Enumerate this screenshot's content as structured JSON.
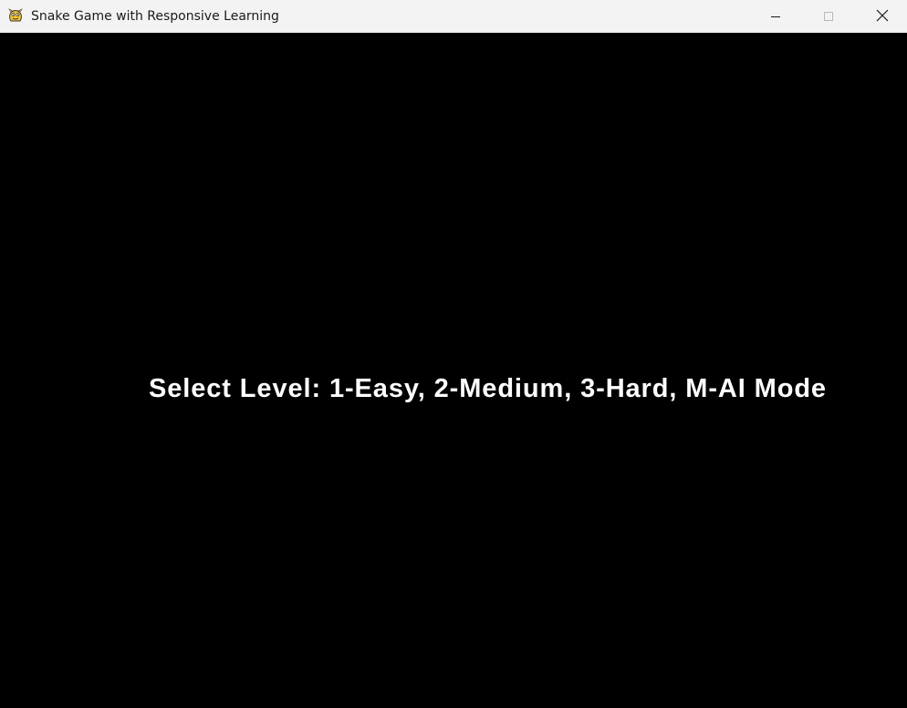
{
  "window": {
    "title": "Snake Game with Responsive Learning",
    "icon": "pygame-snake-icon",
    "controls": {
      "minimize_icon": "minimize-icon",
      "maximize_icon": "maximize-icon",
      "close_icon": "close-icon"
    }
  },
  "game": {
    "background_color": "#000000",
    "text_color": "#ffffff",
    "prompt": "Select Level: 1-Easy, 2-Medium, 3-Hard, M-AI Mode"
  }
}
